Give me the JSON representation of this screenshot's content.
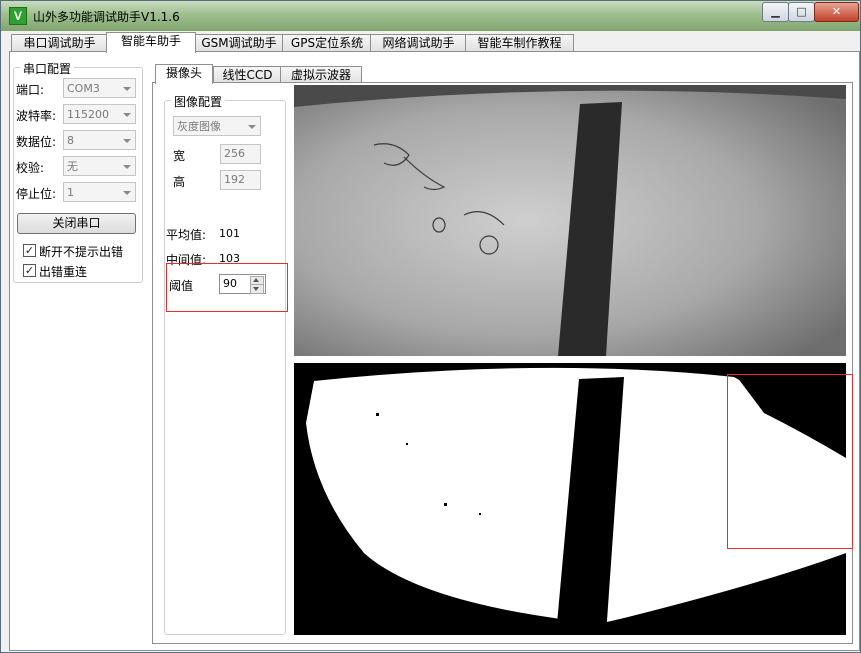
{
  "window": {
    "title": "山外多功能调试助手V1.1.6",
    "icon": "V",
    "controls": {
      "minimize": "▁",
      "maximize": "□",
      "close": "✕"
    }
  },
  "tabs": [
    {
      "label": "串口调试助手"
    },
    {
      "label": "智能车助手",
      "active": true
    },
    {
      "label": "GSM调试助手"
    },
    {
      "label": "GPS定位系统"
    },
    {
      "label": "网络调试助手"
    },
    {
      "label": "智能车制作教程"
    }
  ],
  "serial_config": {
    "title": "串口配置",
    "port": {
      "label": "端口:",
      "value": "COM3"
    },
    "baud": {
      "label": "波特率:",
      "value": "115200"
    },
    "databits": {
      "label": "数据位:",
      "value": "8"
    },
    "parity": {
      "label": "校验:",
      "value": "无"
    },
    "stopbits": {
      "label": "停止位:",
      "value": "1"
    },
    "close_button": "关闭串口",
    "options": [
      {
        "label": "断开不提示出错",
        "checked": true
      },
      {
        "label": "出错重连",
        "checked": true
      }
    ]
  },
  "subtabs": [
    {
      "label": "摄像头",
      "active": true
    },
    {
      "label": "线性CCD"
    },
    {
      "label": "虚拟示波器"
    }
  ],
  "image_config": {
    "title": "图像配置",
    "mode": "灰度图像",
    "width": {
      "label": "宽",
      "value": "256"
    },
    "height": {
      "label": "高",
      "value": "192"
    },
    "mean": {
      "label": "平均值:",
      "value": "101"
    },
    "median": {
      "label": "中间值:",
      "value": "103"
    },
    "threshold": {
      "label": "阈值",
      "value": "90"
    }
  },
  "colors": {
    "accent_red": "#e03030",
    "titlebar": "#9fbf8f"
  }
}
